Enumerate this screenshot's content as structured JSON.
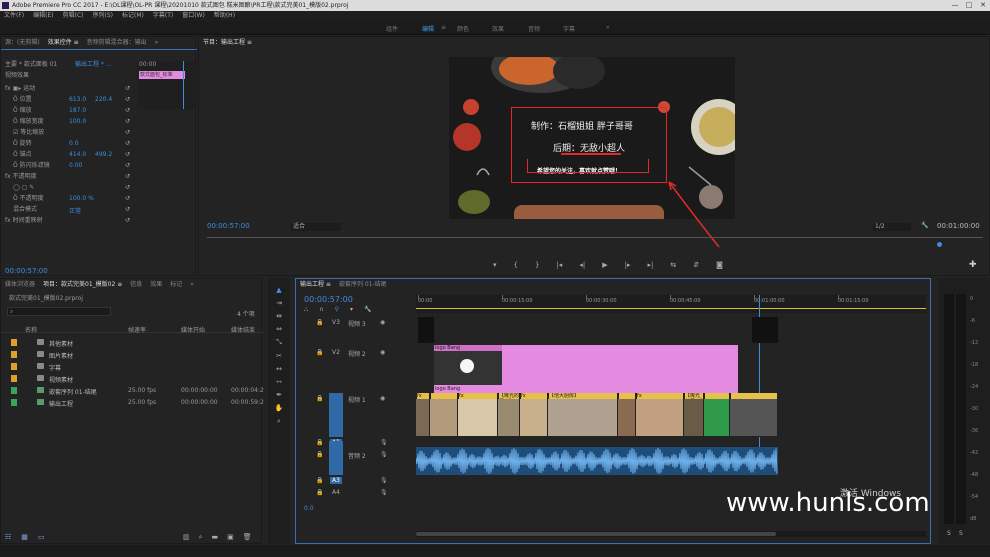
{
  "window": {
    "title": "Adobe Premiere Pro CC 2017 - E:\\OL课程\\OL-PR 课程\\20201010 款式图包 糕米图酿\\PR工程\\款式完美01_模版02.prproj",
    "buttons": [
      "—",
      "□",
      "✕"
    ]
  },
  "menubar": [
    "文件(F)",
    "编辑(E)",
    "剪辑(C)",
    "序列(S)",
    "标记(M)",
    "字幕(T)",
    "窗口(W)",
    "帮助(H)"
  ],
  "workspaces": [
    {
      "label": "组件",
      "active": false
    },
    {
      "label": "编辑",
      "active": true
    },
    {
      "label": "≡",
      "active": false
    },
    {
      "label": "颜色",
      "active": false
    },
    {
      "label": "效果",
      "active": false
    },
    {
      "label": "音频",
      "active": false
    },
    {
      "label": "字幕",
      "active": false
    },
    {
      "label": "»",
      "active": false
    }
  ],
  "effect_controls": {
    "tabs": [
      "源：(无剪辑)",
      "效果控件 ≡",
      "音频剪辑混合器：输出",
      "»"
    ],
    "source_label": "主要 * 款式面板 01",
    "seq_label": "输出工程 * ...",
    "section_video": "视频效果",
    "clip_badge": "款式面包_标准",
    "tc_end": "00:00",
    "rows": [
      {
        "label": "fx ▣▸ 运动",
        "v1": "",
        "v2": ""
      },
      {
        "label": "Ö 位置",
        "v1": "613.0",
        "v2": "220.4"
      },
      {
        "label": "Ö 缩放",
        "v1": "187.0",
        "v2": ""
      },
      {
        "label": "Ö 缩放宽度",
        "v1": "100.0",
        "v2": ""
      },
      {
        "label": "☑ 等比缩放",
        "v1": "",
        "v2": ""
      },
      {
        "label": "Ö 旋转",
        "v1": "0.0",
        "v2": ""
      },
      {
        "label": "Ö 锚点",
        "v1": "414.0",
        "v2": "499.2"
      },
      {
        "label": "Ö 防闪烁滤镜",
        "v1": "0.00",
        "v2": ""
      },
      {
        "label": "fx 不透明度",
        "v1": "",
        "v2": ""
      },
      {
        "label": "◯ ▢ ✎",
        "v1": "",
        "v2": ""
      },
      {
        "label": "Ö 不透明度",
        "v1": "100.0 %",
        "v2": ""
      },
      {
        "label": "混合模式",
        "v1": "正常",
        "v2": ""
      },
      {
        "label": "fx 时间重映射",
        "v1": "",
        "v2": ""
      }
    ],
    "timecode": "00:00:57:00"
  },
  "program": {
    "tab": "节目：输出工程 ≡",
    "timecode": "00:00:57:00",
    "fit": "适合",
    "quality": "1/2",
    "duration": "00:01:00:00",
    "overlay_line1": "制作：石榴姐姐 胖子哥哥",
    "overlay_line2": "后期：无敌小超人",
    "overlay_line3": "希望您的关注，喜欢就点赞哦！",
    "controls": [
      "▾",
      "{",
      "}",
      "|◂",
      "◂|",
      "▶",
      "|▸",
      "▸|",
      "⇆",
      "⇵",
      "◙"
    ]
  },
  "project": {
    "tabs": [
      "媒体浏览器",
      "项目：款式完美01_模版02 ≡",
      "信息",
      "效果",
      "标记",
      "»"
    ],
    "path": "款式完美01_模版02.prproj",
    "count": "4 个项",
    "columns": [
      "名称",
      "帧速率",
      "媒体开始",
      "媒体结束"
    ],
    "items": [
      {
        "type": "folder",
        "name": "其他素材",
        "fps": "",
        "start": "",
        "end": ""
      },
      {
        "type": "folder",
        "name": "图片素材",
        "fps": "",
        "start": "",
        "end": ""
      },
      {
        "type": "folder",
        "name": "字幕",
        "fps": "",
        "start": "",
        "end": ""
      },
      {
        "type": "folder",
        "name": "视频素材",
        "fps": "",
        "start": "",
        "end": ""
      },
      {
        "type": "seq",
        "name": "嵌套序列 01-结尾",
        "fps": "25.00 fps",
        "start": "00:00:00:00",
        "end": "00:00:04:2"
      },
      {
        "type": "seq",
        "name": "输出工程",
        "fps": "25.00 fps",
        "start": "00:00:00:00",
        "end": "00:00:59:2"
      }
    ]
  },
  "timeline": {
    "tabs": [
      "输出工程 ≡",
      "嵌套序列 01-结尾"
    ],
    "timecode": "00:00:57:00",
    "ruler_labels": [
      "00:00",
      "00:00:15:00",
      "00:00:30:00",
      "00:00:45:00",
      "00:01:00:00",
      "00:01:15:00"
    ],
    "tracks": [
      {
        "id": "V3",
        "name": "视频 3"
      },
      {
        "id": "V2",
        "name": "视频 2"
      },
      {
        "id": "V1",
        "name": "视频 1"
      },
      {
        "id": "A1",
        "name": ""
      },
      {
        "id": "A2",
        "name": "音频 2"
      },
      {
        "id": "A3",
        "name": ""
      },
      {
        "id": "A4",
        "name": ""
      }
    ],
    "logo_label": "logo Bang",
    "video_clip_labels": [
      "fx",
      "",
      "fx",
      "【曝光的厨房】",
      "fx",
      "【他大厨房】",
      "",
      "fx",
      "【曝光的厨房】",
      ""
    ],
    "master_value": "0.0"
  },
  "meters": [
    "0",
    "-6",
    "-12",
    "-18",
    "-24",
    "-30",
    "-36",
    "-42",
    "-48",
    "-54",
    "dB"
  ],
  "meter_bottom": [
    "S",
    "S"
  ],
  "watermark": "www.hunls.com",
  "win_activate": "激活 Windows"
}
